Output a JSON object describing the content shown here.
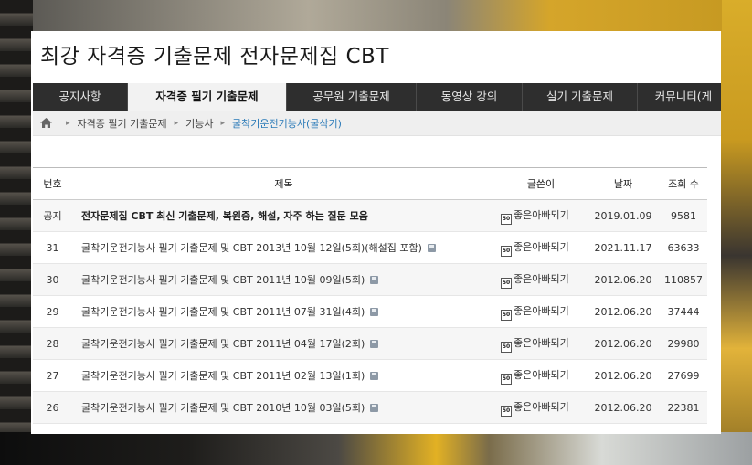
{
  "site_title": "최강 자격증 기출문제 전자문제집 CBT",
  "nav": [
    {
      "label": "공지사항",
      "active": false
    },
    {
      "label": "자격증 필기 기출문제",
      "active": true
    },
    {
      "label": "공무원 기출문제",
      "active": false
    },
    {
      "label": "동영상 강의",
      "active": false
    },
    {
      "label": "실기 기출문제",
      "active": false
    },
    {
      "label": "커뮤니티(게",
      "active": false
    }
  ],
  "breadcrumb": {
    "home_icon": "home-icon",
    "items": [
      "자격증 필기 기출문제",
      "기능사",
      "굴착기운전기능사(굴삭기)"
    ]
  },
  "table": {
    "headers": {
      "no": "번호",
      "title": "제목",
      "author": "글쓴이",
      "date": "날짜",
      "views": "조회 수"
    },
    "rows": [
      {
        "no": "공지",
        "title": "전자문제집 CBT 최신 기출문제, 복원중, 해설, 자주 하는 질문 모음",
        "author": "좋은아빠되기",
        "date": "2019.01.09",
        "views": "9581"
      },
      {
        "no": "31",
        "title": "굴착기운전기능사 필기 기출문제 및 CBT 2013년 10월 12일(5회)(해설집 포함)",
        "author": "좋은아빠되기",
        "date": "2021.11.17",
        "views": "63633"
      },
      {
        "no": "30",
        "title": "굴착기운전기능사 필기 기출문제 및 CBT 2011년 10월 09일(5회)",
        "author": "좋은아빠되기",
        "date": "2012.06.20",
        "views": "110857"
      },
      {
        "no": "29",
        "title": "굴착기운전기능사 필기 기출문제 및 CBT 2011년 07월 31일(4회)",
        "author": "좋은아빠되기",
        "date": "2012.06.20",
        "views": "37444"
      },
      {
        "no": "28",
        "title": "굴착기운전기능사 필기 기출문제 및 CBT 2011년 04월 17일(2회)",
        "author": "좋은아빠되기",
        "date": "2012.06.20",
        "views": "29980"
      },
      {
        "no": "27",
        "title": "굴착기운전기능사 필기 기출문제 및 CBT 2011년 02월 13일(1회)",
        "author": "좋은아빠되기",
        "date": "2012.06.20",
        "views": "27699"
      },
      {
        "no": "26",
        "title": "굴착기운전기능사 필기 기출문제 및 CBT 2010년 10월 03일(5회)",
        "author": "좋은아빠되기",
        "date": "2012.06.20",
        "views": "22381"
      }
    ],
    "author_badge": "50",
    "attachment_icon": "floppy-disk-icon"
  }
}
